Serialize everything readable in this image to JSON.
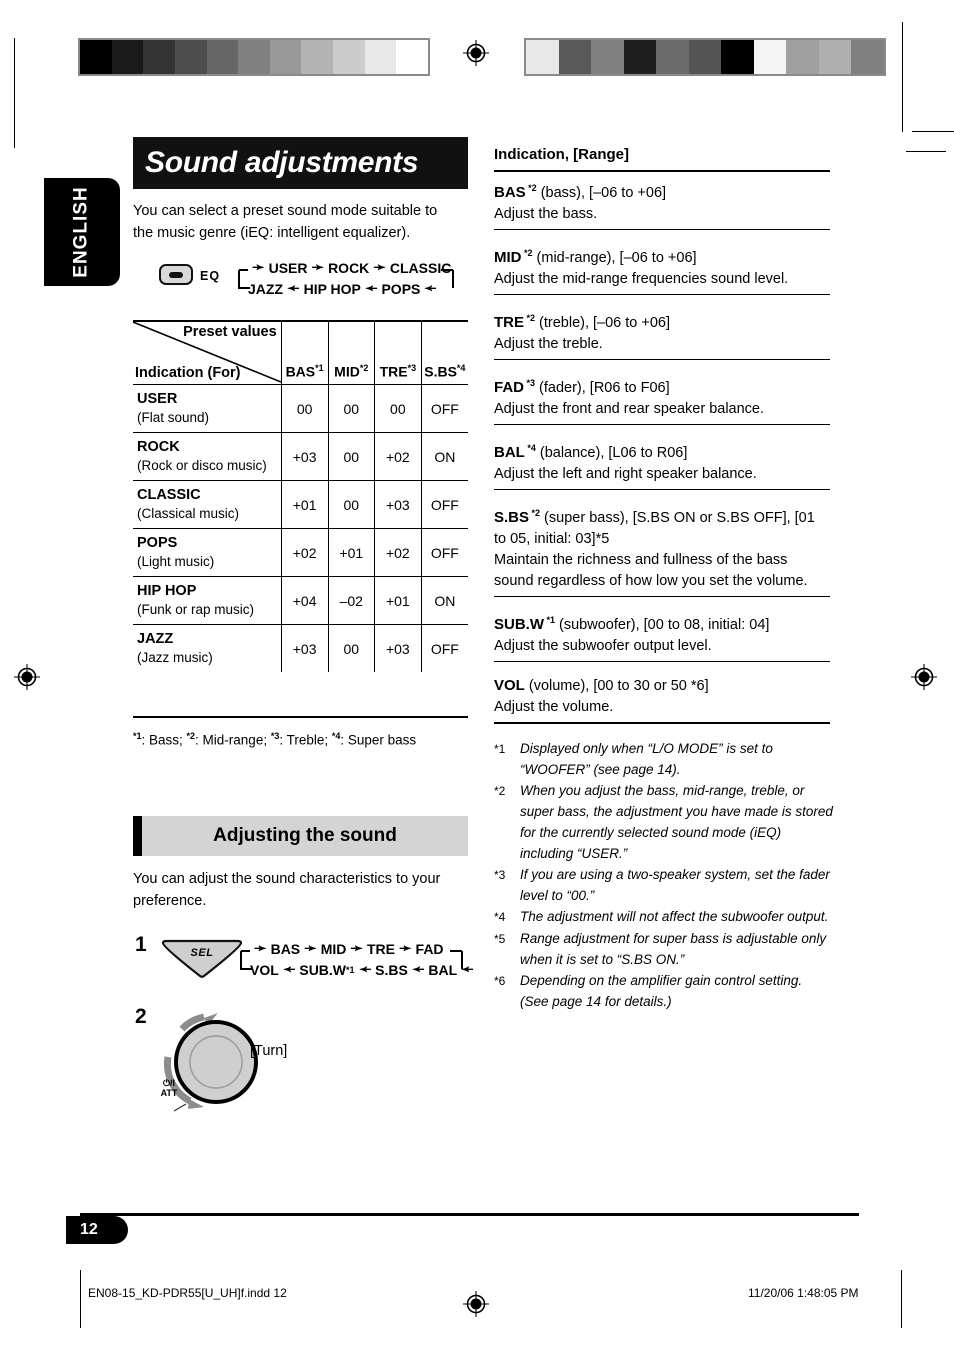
{
  "language_tab": "ENGLISH",
  "page_number": "12",
  "header": {
    "title": "Sound adjustments",
    "intro": "You can select a preset sound mode suitable to the music genre (iEQ: intelligent equalizer)."
  },
  "eq_control": {
    "button_label": "EQ",
    "cycle_top": [
      "USER",
      "ROCK",
      "CLASSIC"
    ],
    "cycle_bottom": [
      "JAZZ",
      "HIP HOP",
      "POPS"
    ]
  },
  "preset_table": {
    "corner_top": "Preset values",
    "corner_bottom": "Indication (For)",
    "columns": [
      {
        "label": "BAS",
        "note": "*1"
      },
      {
        "label": "MID",
        "note": "*2"
      },
      {
        "label": "TRE",
        "note": "*3"
      },
      {
        "label": "S.BS",
        "note": "*4"
      }
    ],
    "rows": [
      {
        "name": "USER",
        "desc": "(Flat sound)",
        "values": [
          "00",
          "00",
          "00",
          "OFF"
        ]
      },
      {
        "name": "ROCK",
        "desc": "(Rock or disco music)",
        "values": [
          "+03",
          "00",
          "+02",
          "ON"
        ]
      },
      {
        "name": "CLASSIC",
        "desc": "(Classical music)",
        "values": [
          "+01",
          "00",
          "+03",
          "OFF"
        ]
      },
      {
        "name": "POPS",
        "desc": "(Light music)",
        "values": [
          "+02",
          "+01",
          "+02",
          "OFF"
        ]
      },
      {
        "name": "HIP HOP",
        "desc": "(Funk or rap music)",
        "values": [
          "+04",
          "–02",
          "+01",
          "ON"
        ]
      },
      {
        "name": "JAZZ",
        "desc": "(Jazz music)",
        "values": [
          "+03",
          "00",
          "+03",
          "OFF"
        ]
      }
    ],
    "footnote": ": Bass;  : Mid-range;  : Treble;  : Super bass",
    "footnote_parts": [
      {
        "mark": "*1",
        "text": ": Bass;"
      },
      {
        "mark": "*2",
        "text": ": Mid-range;"
      },
      {
        "mark": "*3",
        "text": ": Treble;"
      },
      {
        "mark": "*4",
        "text": ": Super bass"
      }
    ]
  },
  "adjusting": {
    "heading": "Adjusting the sound",
    "intro": "You can adjust the sound characteristics to your preference.",
    "step1_number": "1",
    "step1_button": "SEL",
    "cycle_top": [
      "BAS",
      "MID",
      "TRE",
      "FAD"
    ],
    "cycle_bottom_labels": [
      "VOL",
      "SUB.W",
      "S.BS",
      "BAL"
    ],
    "sub_w_note": "*1",
    "step2_number": "2",
    "turn_label": "[Turn]",
    "knob_label_line1": "⏻/I",
    "knob_label_line2": "ATT"
  },
  "right_column": {
    "heading": "Indication, [Range]",
    "entries": [
      {
        "term": "BAS",
        "note": "*2",
        "range": "(bass), [–06 to +06]",
        "desc": "Adjust the bass."
      },
      {
        "term": "MID",
        "note": "*2",
        "range": "(mid-range), [–06 to +06]",
        "desc": "Adjust the mid-range frequencies sound level."
      },
      {
        "term": "TRE",
        "note": "*2",
        "range": "(treble), [–06 to +06]",
        "desc": "Adjust the treble."
      },
      {
        "term": "FAD",
        "note": "*3",
        "range": "(fader), [R06 to F06]",
        "desc": "Adjust the front and rear speaker balance."
      },
      {
        "term": "BAL",
        "note": "*4",
        "range": "(balance), [L06 to R06]",
        "desc": "Adjust the left and right speaker balance."
      },
      {
        "term": "S.BS",
        "note": "*2",
        "range": "(super bass), [S.BS ON or S.BS OFF], [01 to 05, initial: 03]*5",
        "desc": "Maintain the richness and fullness of the bass sound regardless of how low you set the volume."
      },
      {
        "term": "SUB.W",
        "note": "*1",
        "range": "(subwoofer), [00 to 08, initial: 04]",
        "desc": "Adjust the subwoofer output level."
      },
      {
        "term": "VOL",
        "note": "",
        "range": "(volume), [00 to 30 or 50 *6]",
        "desc": "Adjust the volume."
      }
    ],
    "notes": [
      {
        "mark": "*1",
        "text": "Displayed only when “L/O MODE” is set to “WOOFER” (see page 14)."
      },
      {
        "mark": "*2",
        "text": "When you adjust the bass, mid-range, treble, or super bass, the adjustment you have made is stored for the currently selected sound mode (iEQ) including “USER.”"
      },
      {
        "mark": "*3",
        "text": "If you are using a two-speaker system, set the fader level to “00.”"
      },
      {
        "mark": "*4",
        "text": "The adjustment will not affect the subwoofer output."
      },
      {
        "mark": "*5",
        "text": "Range adjustment for super bass is adjustable only when it is set to “S.BS ON.”"
      },
      {
        "mark": "*6",
        "text": "Depending on the amplifier gain control setting. (See page 14 for details.)"
      }
    ]
  },
  "footer": {
    "file_name": "EN08-15_KD-PDR55[U_UH]f.indd   12",
    "timestamp": "11/20/06   1:48:05 PM"
  },
  "calibration": {
    "left_bar": [
      "#000000",
      "#1a1a1a",
      "#333333",
      "#4d4d4d",
      "#666666",
      "#808080",
      "#999999",
      "#b3b3b3",
      "#cccccc",
      "#e8e8e8",
      "#ffffff"
    ],
    "right_bar": [
      "#e8e8e8",
      "#595959",
      "#808080",
      "#1f1f1f",
      "#6b6b6b",
      "#555555",
      "#000000",
      "#f5f5f5",
      "#a0a0a0",
      "#b0b0b0",
      "#808080"
    ]
  }
}
